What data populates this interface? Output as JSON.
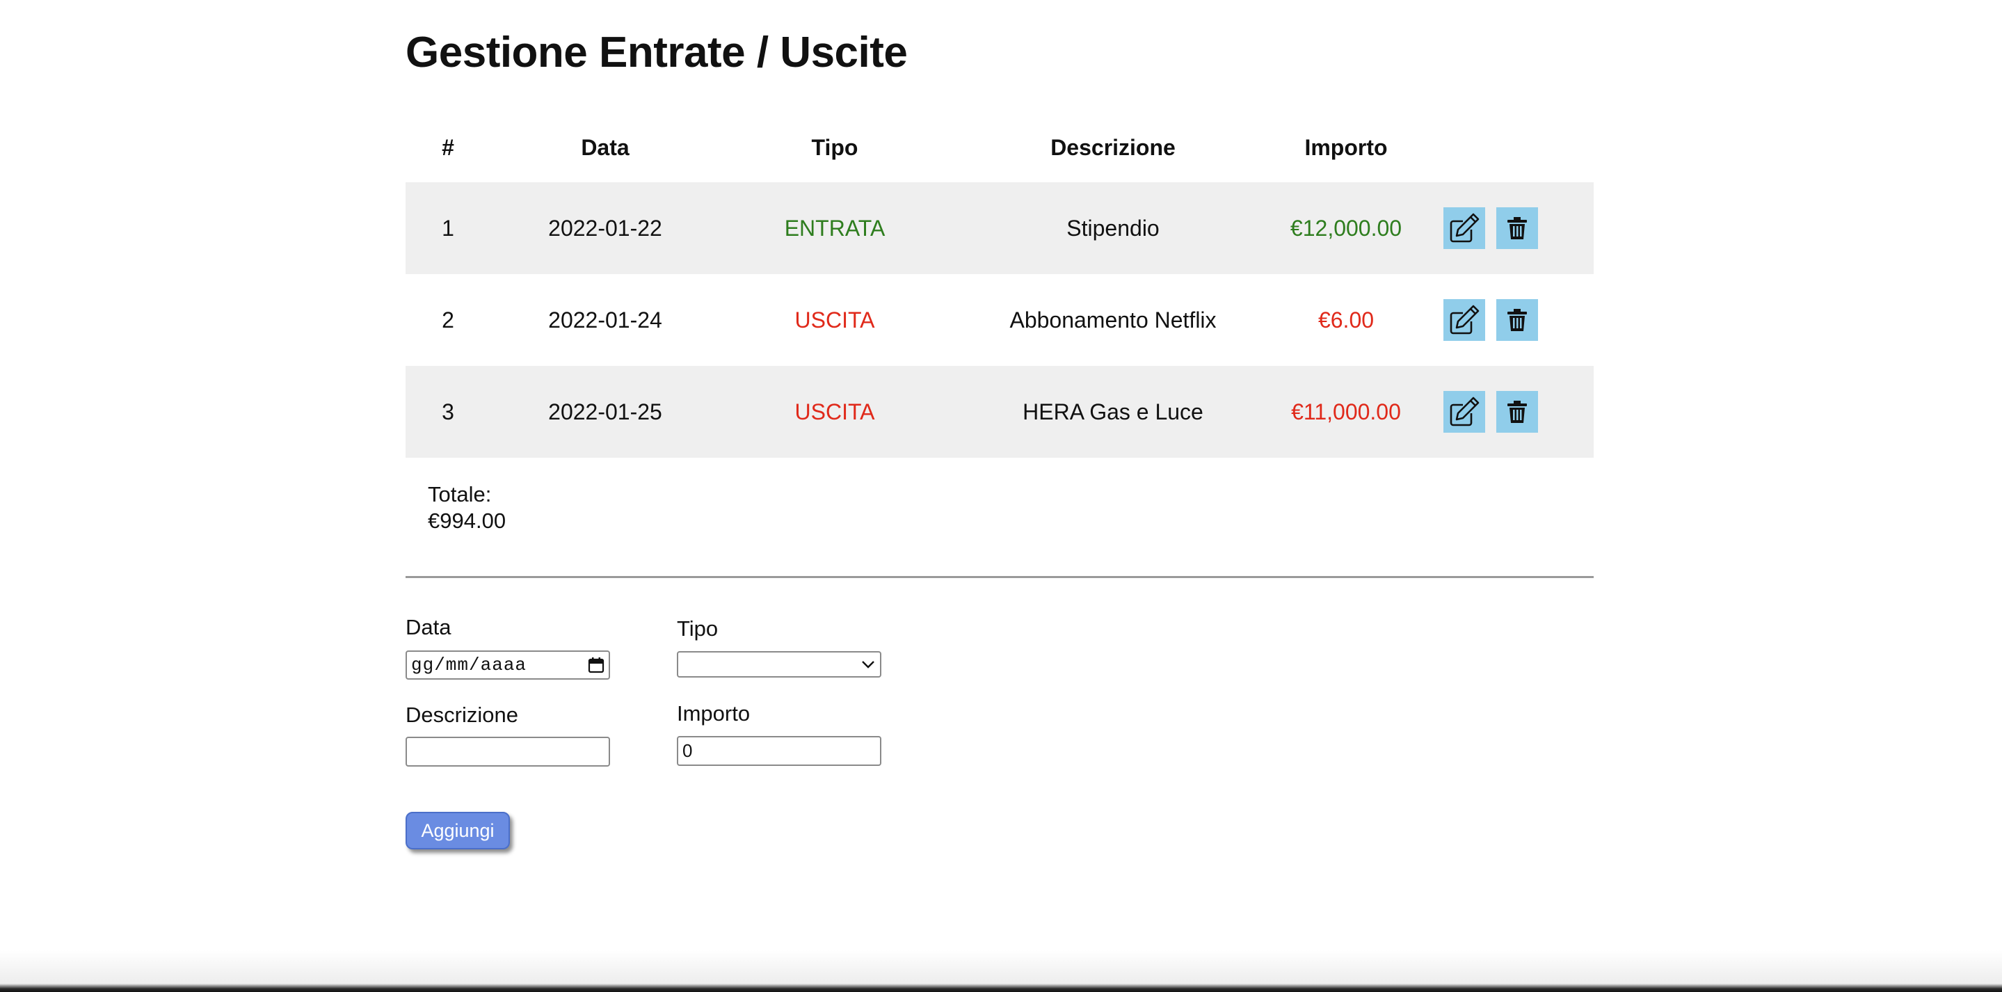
{
  "title": "Gestione Entrate / Uscite",
  "table": {
    "headers": [
      "#",
      "Data",
      "Tipo",
      "Descrizione",
      "Importo"
    ],
    "rows": [
      {
        "num": "1",
        "date": "2022-01-22",
        "type": "ENTRATA",
        "description": "Stipendio",
        "amount": "€12,000.00"
      },
      {
        "num": "2",
        "date": "2022-01-24",
        "type": "USCITA",
        "description": "Abbonamento Netflix",
        "amount": "€6.00"
      },
      {
        "num": "3",
        "date": "2022-01-25",
        "type": "USCITA",
        "description": "HERA Gas e Luce",
        "amount": "€11,000.00"
      }
    ]
  },
  "total": {
    "label": "Totale:",
    "value": "€994.00"
  },
  "form": {
    "date_label": "Data",
    "date_placeholder": "gg/mm/aaaa",
    "type_label": "Tipo",
    "type_value": "",
    "description_label": "Descrizione",
    "description_value": "",
    "amount_label": "Importo",
    "amount_value": "0",
    "submit_label": "Aggiungi"
  },
  "colors": {
    "income": "#2e7d1e",
    "expense": "#e0291a",
    "action_button": "#90cdea",
    "submit_button": "#6a8ce2",
    "row_stripe": "#efefef"
  },
  "icons": {
    "edit": "edit-icon",
    "delete": "trash-icon",
    "calendar": "calendar-icon",
    "dropdown": "chevron-down-icon"
  }
}
